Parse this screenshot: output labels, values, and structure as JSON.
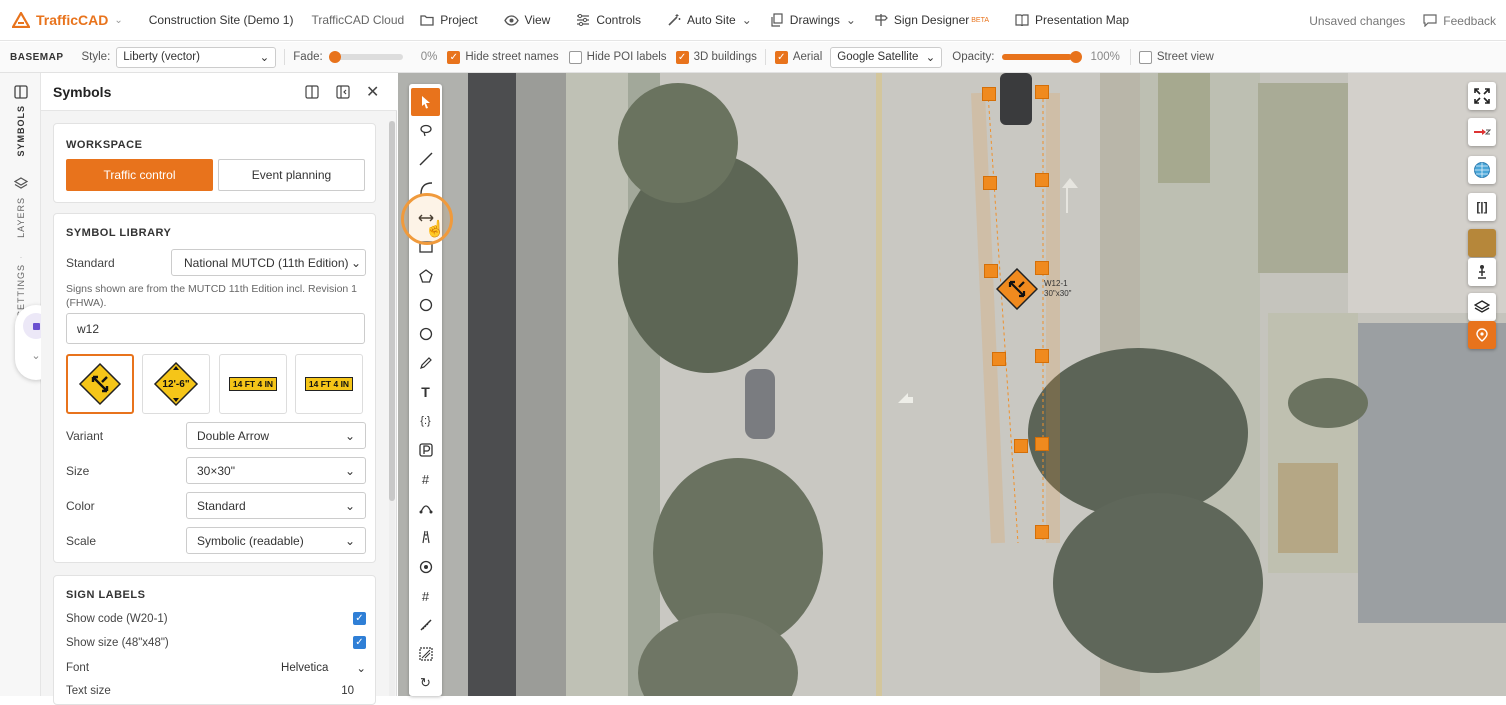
{
  "topbar": {
    "brand": "TrafficCAD",
    "site": "Construction Site (Demo 1)",
    "cloud": "TrafficCAD Cloud",
    "nav": {
      "project": "Project",
      "view": "View",
      "controls": "Controls",
      "auto_site": "Auto Site",
      "drawings": "Drawings",
      "sign_designer": "Sign Designer",
      "beta": "BETA",
      "presentation_map": "Presentation Map"
    },
    "unsaved": "Unsaved changes",
    "feedback": "Feedback"
  },
  "basemap": {
    "label": "BASEMAP",
    "style_label": "Style:",
    "style_value": "Liberty (vector)",
    "fade_label": "Fade:",
    "fade_percent": "0%",
    "fade_value": 0,
    "hide_street_names": "Hide street names",
    "hide_poi_labels": "Hide POI labels",
    "buildings_3d": "3D buildings",
    "aerial": "Aerial",
    "aerial_source": "Google Satellite",
    "opacity_label": "Opacity:",
    "opacity_percent": "100%",
    "opacity_value": 1.0,
    "street_view": "Street view",
    "checks": {
      "hide_street_names": true,
      "hide_poi_labels": false,
      "buildings_3d": true,
      "aerial": true,
      "street_view": false
    }
  },
  "rail": {
    "symbols": "SYMBOLS",
    "layers": "LAYERS",
    "settings": "SETTINGS"
  },
  "panel": {
    "title": "Symbols",
    "workspace": {
      "title": "WORKSPACE",
      "traffic_control": "Traffic control",
      "event_planning": "Event planning"
    },
    "library": {
      "title": "SYMBOL LIBRARY",
      "standard_label": "Standard",
      "standard_value": "National MUTCD (11th Edition)",
      "note": "Signs shown are from the MUTCD 11th Edition incl. Revision 1 (FHWA).",
      "search_value": "w12",
      "tile2_text": "12'-6\"",
      "tile3_text": "14 FT 4 IN",
      "tile4_text": "14 FT 4 IN",
      "variant_label": "Variant",
      "variant_value": "Double Arrow",
      "size_label": "Size",
      "size_value": "30×30\"",
      "color_label": "Color",
      "color_value": "Standard",
      "scale_label": "Scale",
      "scale_value": "Symbolic (readable)"
    },
    "sign_labels": {
      "title": "SIGN LABELS",
      "show_code": "Show code (W20-1)",
      "show_size": "Show size (48\"x48\")",
      "font_label": "Font",
      "font_value": "Helvetica",
      "text_size_label": "Text size",
      "text_size_value": "10"
    }
  },
  "map": {
    "sign_code": "W12-1",
    "sign_size": "30\"x30\""
  },
  "colors": {
    "accent": "#e8731c",
    "sign_yellow": "#f5c518",
    "check_blue": "#2f7fd6"
  }
}
